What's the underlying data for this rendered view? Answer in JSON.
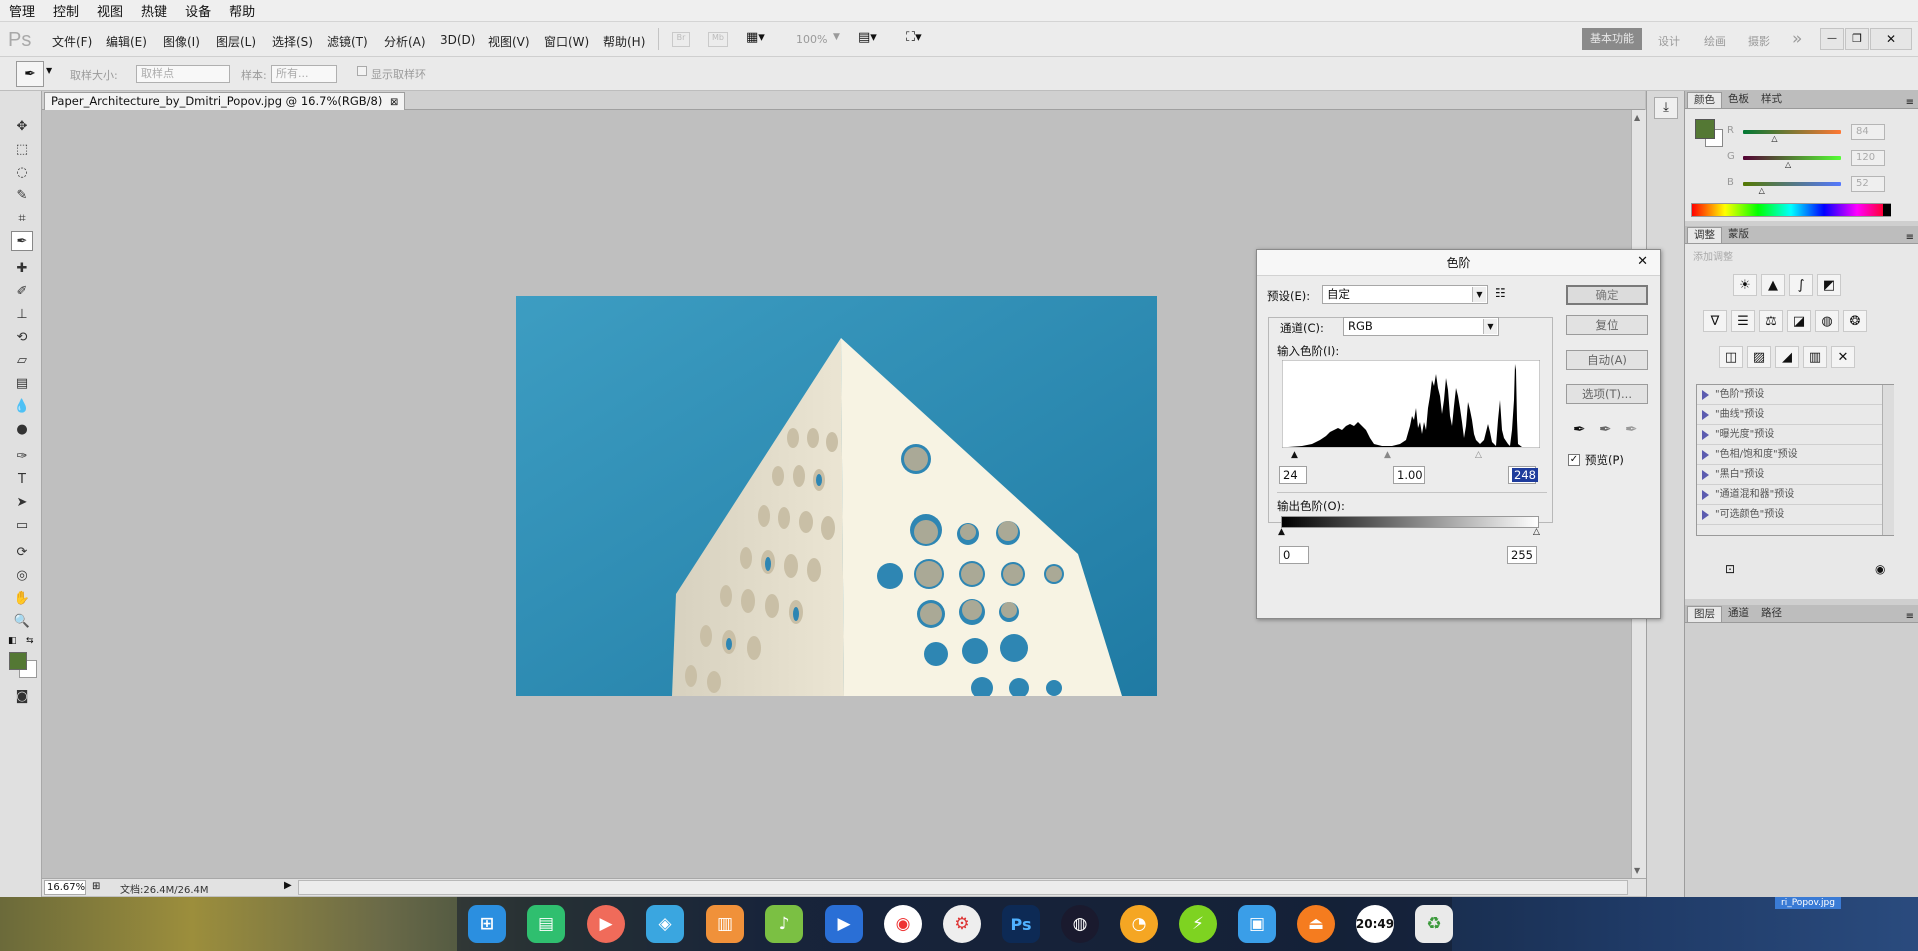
{
  "os_menu": [
    "管理",
    "控制",
    "视图",
    "热键",
    "设备",
    "帮助"
  ],
  "app": {
    "logo": "Ps",
    "menus": [
      "文件(F)",
      "编辑(E)",
      "图像(I)",
      "图层(L)",
      "选择(S)",
      "滤镜(T)",
      "分析(A)",
      "3D(D)",
      "视图(V)",
      "窗口(W)",
      "帮助(H)"
    ],
    "zoom": "100%",
    "workspace_active": "基本功能",
    "workspaces": [
      "设计",
      "绘画",
      "摄影"
    ],
    "expand": "»"
  },
  "options_bar": {
    "sample_size_label": "取样大小:",
    "sample_size_value": "取样点",
    "sample_label": "样本:",
    "sample_value": "所有...",
    "show_ring_label": "显示取样环"
  },
  "document": {
    "tab_title": "Paper_Architecture_by_Dmitri_Popov.jpg @ 16.7%(RGB/8)",
    "close": "⊠",
    "zoom_status": "16.67%",
    "doc_info": "文档:26.4M/26.4M"
  },
  "panels": {
    "color_tabs": [
      "颜色",
      "色板",
      "样式"
    ],
    "rgb": [
      {
        "label": "R",
        "value": "84",
        "level": 0.33
      },
      {
        "label": "G",
        "value": "120",
        "level": 0.47
      },
      {
        "label": "B",
        "value": "52",
        "level": 0.2
      }
    ],
    "foreground_color": "#547834",
    "adjust_tabs": [
      "调整",
      "蒙版"
    ],
    "adjust_hint": "添加调整",
    "presets": [
      "\"色阶\"预设",
      "\"曲线\"预设",
      "\"曝光度\"预设",
      "\"色相/饱和度\"预设",
      "\"黑白\"预设",
      "\"通道混和器\"预设",
      "\"可选颜色\"预设"
    ],
    "layers_tabs": [
      "图层",
      "通道",
      "路径"
    ]
  },
  "levels_dialog": {
    "title": "色阶",
    "close": "✕",
    "preset_label": "预设(E):",
    "preset_value": "自定",
    "channel_label": "通道(C):",
    "channel_value": "RGB",
    "input_label": "输入色阶(I):",
    "input_black": "24",
    "input_gamma": "1.00",
    "input_white": "248",
    "output_label": "输出色阶(O):",
    "output_black": "0",
    "output_white": "255",
    "buttons": [
      "确定",
      "复位",
      "自动(A)",
      "选项(T)..."
    ],
    "preview_label": "预览(P)",
    "preview_checked": true
  },
  "taskbar": {
    "clock": "20:49",
    "window_label": "ri_Popov.jpg"
  }
}
